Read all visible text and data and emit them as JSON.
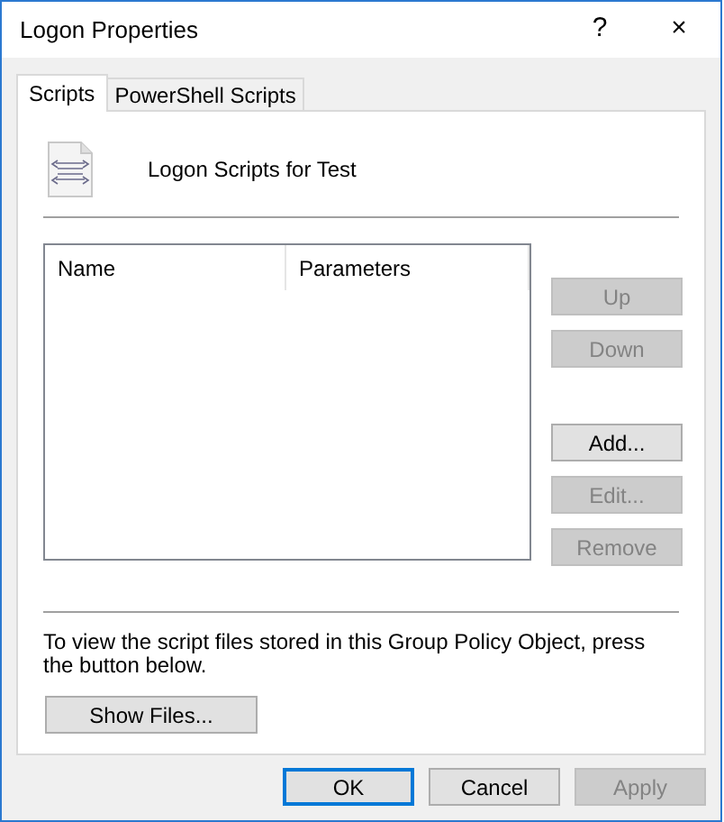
{
  "window": {
    "title": "Logon Properties",
    "title_buttons": [
      "?",
      "×"
    ]
  },
  "tabs": [
    {
      "label": "Scripts",
      "selected": true
    },
    {
      "label": "PowerShell Scripts",
      "selected": false
    }
  ],
  "header": {
    "title": "Logon Scripts for Test"
  },
  "list": {
    "columns": [
      "Name",
      "Parameters"
    ]
  },
  "order_buttons": [
    {
      "label": "Up",
      "disabled": true
    },
    {
      "label": "Down",
      "disabled": true
    }
  ],
  "edit_buttons": [
    {
      "label": "Add...",
      "disabled": false
    },
    {
      "label": "Edit...",
      "disabled": true
    },
    {
      "label": "Remove",
      "disabled": true
    }
  ],
  "info_lines": [
    "To view the script files stored in this Group Policy Object, press",
    "the button below."
  ],
  "show_files": {
    "label": "Show Files...",
    "disabled": false
  },
  "footer_buttons": [
    {
      "label": "OK",
      "disabled": false,
      "default": true
    },
    {
      "label": "Cancel",
      "disabled": false,
      "default": false
    },
    {
      "label": "Apply",
      "disabled": true,
      "default": false
    }
  ]
}
